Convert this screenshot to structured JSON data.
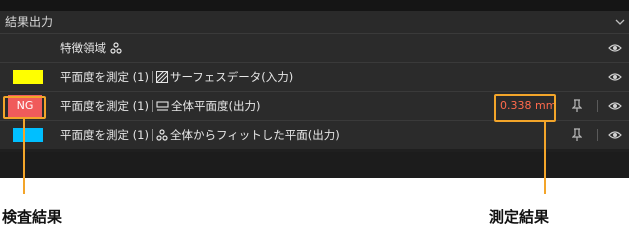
{
  "header": {
    "title": "結果出力"
  },
  "rows": [
    {
      "label": "特徴領域",
      "icon": "cluster-icon"
    },
    {
      "label_main": "平面度を測定 (1)",
      "label_sub": "サーフェスデータ(入力)",
      "swatch_color": "#ffff00",
      "icon": "surface-icon"
    },
    {
      "label_main": "平面度を測定 (1)",
      "label_sub": "全体平面度(出力)",
      "result": "NG",
      "value": "0.338 mm",
      "icon": "flatness-icon"
    },
    {
      "label_main": "平面度を測定 (1)",
      "label_sub": "全体からフィットした平面(出力)",
      "swatch_color": "#00bfff",
      "icon": "cluster-icon"
    }
  ],
  "annotations": {
    "result_caption": "検査結果",
    "value_caption": "測定結果"
  },
  "colors": {
    "highlight": "#f3a52a",
    "ng": "#f05b5b",
    "value_text": "#ff6a4c"
  }
}
